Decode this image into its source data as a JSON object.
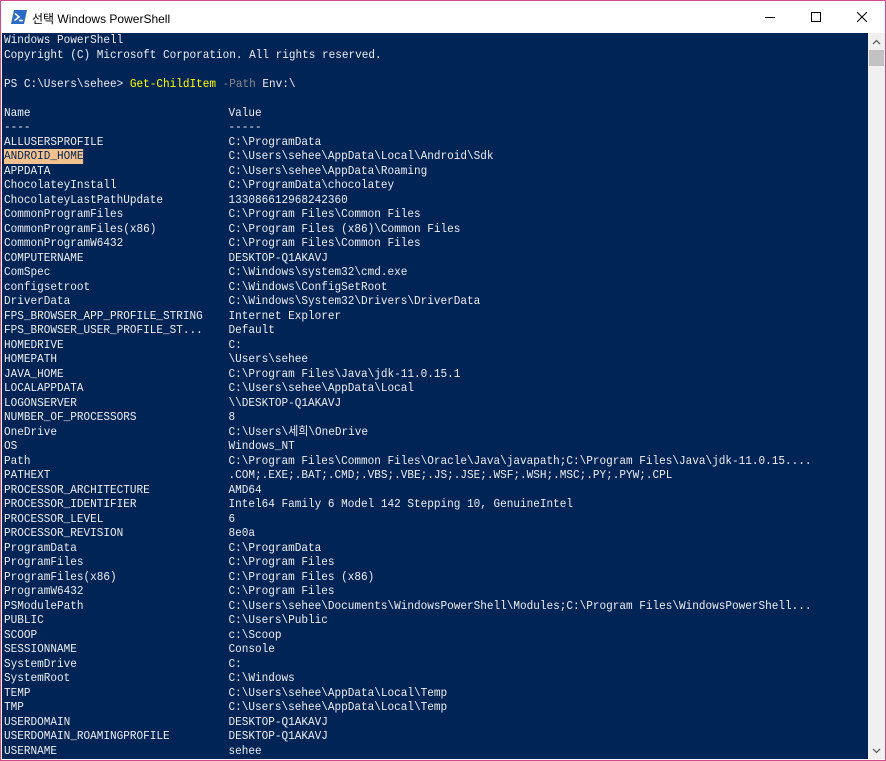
{
  "window": {
    "title": "선택 Windows PowerShell",
    "icon": "powershell-icon",
    "colors": {
      "console_bg": "#012456",
      "console_fg": "#eeedf0",
      "command": "#ffff00",
      "parameter": "#8a8a8a",
      "selection": "#f2c28e",
      "frame": "#d04a8a"
    }
  },
  "console": {
    "banner": [
      "Windows PowerShell",
      "Copyright (C) Microsoft Corporation. All rights reserved."
    ],
    "prompt": "PS C:\\Users\\sehee>",
    "command": "Get-ChildItem",
    "parameter": "-Path",
    "argument": "Env:\\",
    "header": {
      "name": "Name",
      "value": "Value",
      "name_rule": "----",
      "value_rule": "-----"
    },
    "rows": [
      {
        "name": "ALLUSERSPROFILE",
        "value": "C:\\ProgramData"
      },
      {
        "name": "ANDROID_HOME",
        "value": "C:\\Users\\sehee\\AppData\\Local\\Android\\Sdk",
        "selected": true
      },
      {
        "name": "APPDATA",
        "value": "C:\\Users\\sehee\\AppData\\Roaming"
      },
      {
        "name": "ChocolateyInstall",
        "value": "C:\\ProgramData\\chocolatey"
      },
      {
        "name": "ChocolateyLastPathUpdate",
        "value": "133086612968242360"
      },
      {
        "name": "CommonProgramFiles",
        "value": "C:\\Program Files\\Common Files"
      },
      {
        "name": "CommonProgramFiles(x86)",
        "value": "C:\\Program Files (x86)\\Common Files"
      },
      {
        "name": "CommonProgramW6432",
        "value": "C:\\Program Files\\Common Files"
      },
      {
        "name": "COMPUTERNAME",
        "value": "DESKTOP-Q1AKAVJ"
      },
      {
        "name": "ComSpec",
        "value": "C:\\Windows\\system32\\cmd.exe"
      },
      {
        "name": "configsetroot",
        "value": "C:\\Windows\\ConfigSetRoot"
      },
      {
        "name": "DriverData",
        "value": "C:\\Windows\\System32\\Drivers\\DriverData"
      },
      {
        "name": "FPS_BROWSER_APP_PROFILE_STRING",
        "value": "Internet Explorer"
      },
      {
        "name": "FPS_BROWSER_USER_PROFILE_ST...",
        "value": "Default"
      },
      {
        "name": "HOMEDRIVE",
        "value": "C:"
      },
      {
        "name": "HOMEPATH",
        "value": "\\Users\\sehee"
      },
      {
        "name": "JAVA_HOME",
        "value": "C:\\Program Files\\Java\\jdk-11.0.15.1"
      },
      {
        "name": "LOCALAPPDATA",
        "value": "C:\\Users\\sehee\\AppData\\Local"
      },
      {
        "name": "LOGONSERVER",
        "value": "\\\\DESKTOP-Q1AKAVJ"
      },
      {
        "name": "NUMBER_OF_PROCESSORS",
        "value": "8"
      },
      {
        "name": "OneDrive",
        "value": "C:\\Users\\세희\\OneDrive"
      },
      {
        "name": "OS",
        "value": "Windows_NT"
      },
      {
        "name": "Path",
        "value": "C:\\Program Files\\Common Files\\Oracle\\Java\\javapath;C:\\Program Files\\Java\\jdk-11.0.15...."
      },
      {
        "name": "PATHEXT",
        "value": ".COM;.EXE;.BAT;.CMD;.VBS;.VBE;.JS;.JSE;.WSF;.WSH;.MSC;.PY;.PYW;.CPL"
      },
      {
        "name": "PROCESSOR_ARCHITECTURE",
        "value": "AMD64"
      },
      {
        "name": "PROCESSOR_IDENTIFIER",
        "value": "Intel64 Family 6 Model 142 Stepping 10, GenuineIntel"
      },
      {
        "name": "PROCESSOR_LEVEL",
        "value": "6"
      },
      {
        "name": "PROCESSOR_REVISION",
        "value": "8e0a"
      },
      {
        "name": "ProgramData",
        "value": "C:\\ProgramData"
      },
      {
        "name": "ProgramFiles",
        "value": "C:\\Program Files"
      },
      {
        "name": "ProgramFiles(x86)",
        "value": "C:\\Program Files (x86)"
      },
      {
        "name": "ProgramW6432",
        "value": "C:\\Program Files"
      },
      {
        "name": "PSModulePath",
        "value": "C:\\Users\\sehee\\Documents\\WindowsPowerShell\\Modules;C:\\Program Files\\WindowsPowerShell..."
      },
      {
        "name": "PUBLIC",
        "value": "C:\\Users\\Public"
      },
      {
        "name": "SCOOP",
        "value": "c:\\Scoop"
      },
      {
        "name": "SESSIONNAME",
        "value": "Console"
      },
      {
        "name": "SystemDrive",
        "value": "C:"
      },
      {
        "name": "SystemRoot",
        "value": "C:\\Windows"
      },
      {
        "name": "TEMP",
        "value": "C:\\Users\\sehee\\AppData\\Local\\Temp"
      },
      {
        "name": "TMP",
        "value": "C:\\Users\\sehee\\AppData\\Local\\Temp"
      },
      {
        "name": "USERDOMAIN",
        "value": "DESKTOP-Q1AKAVJ"
      },
      {
        "name": "USERDOMAIN_ROAMINGPROFILE",
        "value": "DESKTOP-Q1AKAVJ"
      },
      {
        "name": "USERNAME",
        "value": "sehee"
      }
    ]
  }
}
